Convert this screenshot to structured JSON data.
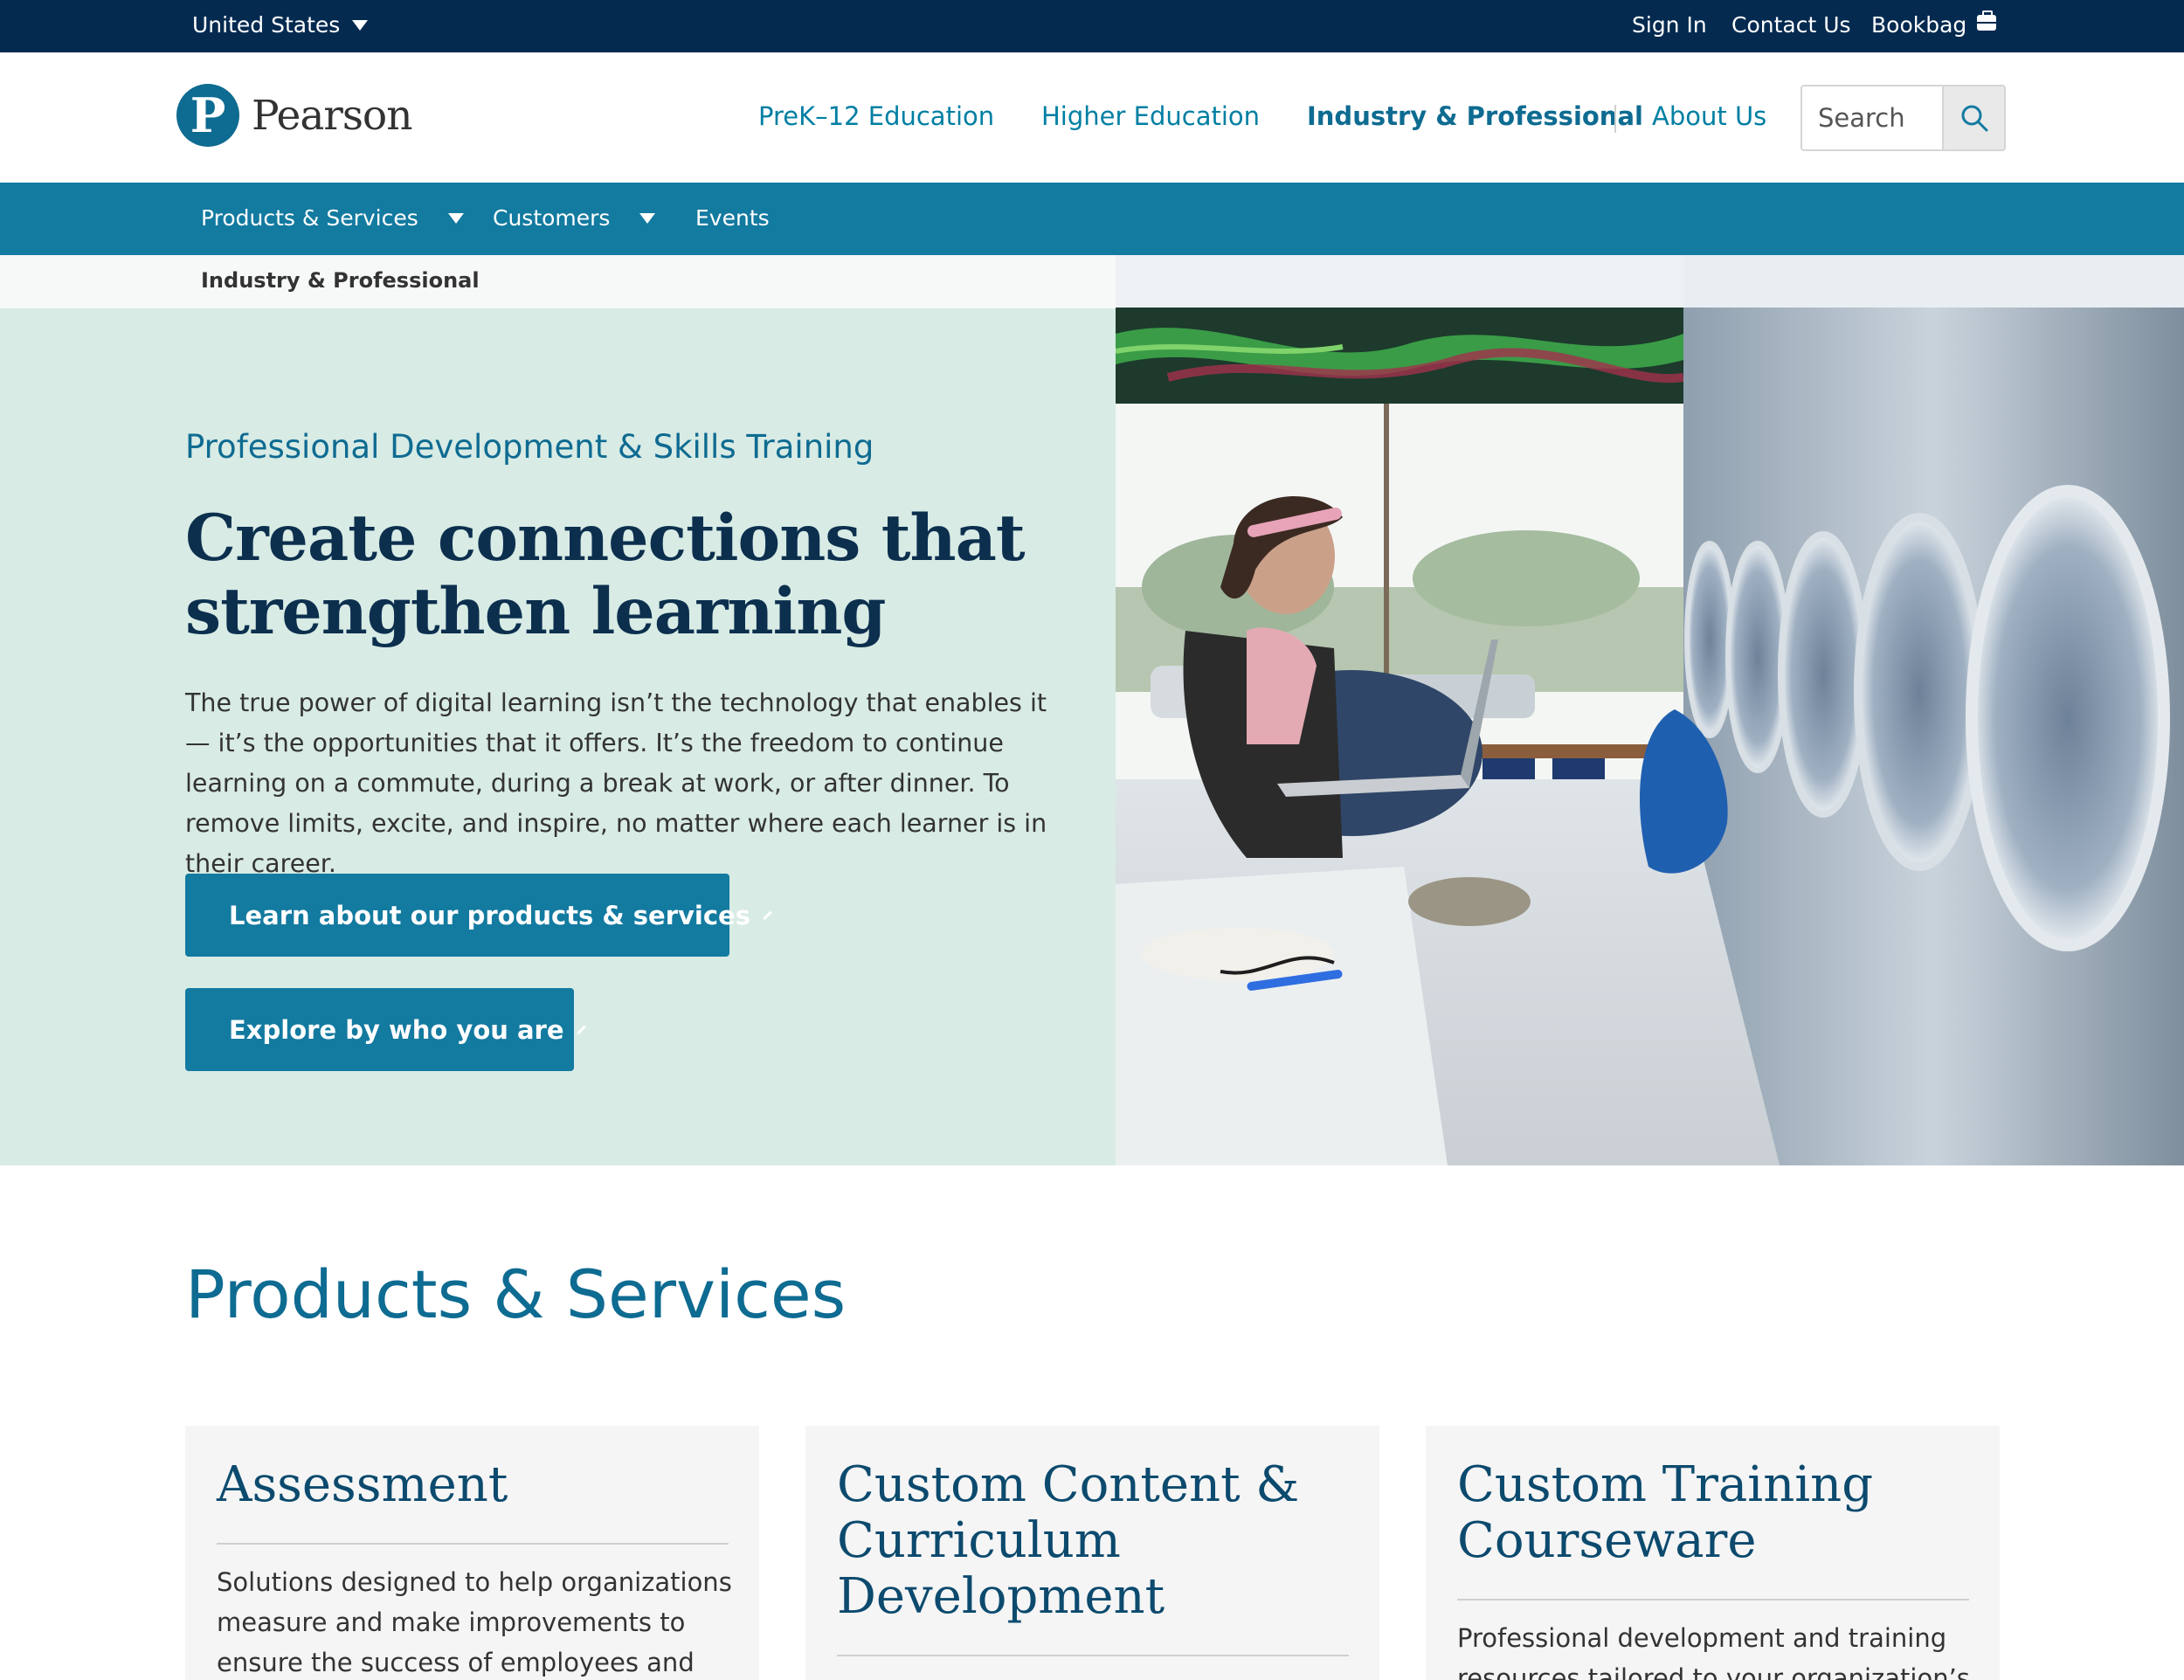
{
  "topbar": {
    "country": "United States",
    "sign_in": "Sign In",
    "contact": "Contact Us",
    "bookbag": "Bookbag"
  },
  "header": {
    "logo_text": "Pearson",
    "nav": [
      "PreK–12 Education",
      "Higher Education",
      "Industry & Professional",
      "About Us"
    ],
    "active_nav": "Industry & Professional",
    "search_placeholder": "Search"
  },
  "subnav": {
    "items": [
      "Products & Services",
      "Customers",
      "Events"
    ]
  },
  "breadcrumb": "Industry & Professional",
  "hero": {
    "eyebrow": "Professional Development & Skills Training",
    "title": "Create connections that strengthen learning",
    "body": "The true power of digital learning isn’t the technology that enables it — it’s the opportunities that it offers. It’s the freedom to continue learning on a commute, during a break at work, or after dinner. To remove limits, excite, and inspire, no matter where each learner is in their career.",
    "cta_primary": "Learn about our products & services",
    "cta_secondary": "Explore by who you are"
  },
  "products": {
    "title": "Products & Services",
    "cards": [
      {
        "title": "Assessment",
        "text": "Solutions designed to help organizations measure and make improvements to ensure the success of employees and"
      },
      {
        "title": "Custom Content & Curriculum Development",
        "text": ""
      },
      {
        "title": "Custom Training Courseware",
        "text": "Professional development and training resources tailored to your organization’s"
      }
    ]
  },
  "colors": {
    "topbar": "#042a50",
    "brand": "#137aa0",
    "hero_bg": "#d8ebe5",
    "heading": "#0c2f4e"
  }
}
